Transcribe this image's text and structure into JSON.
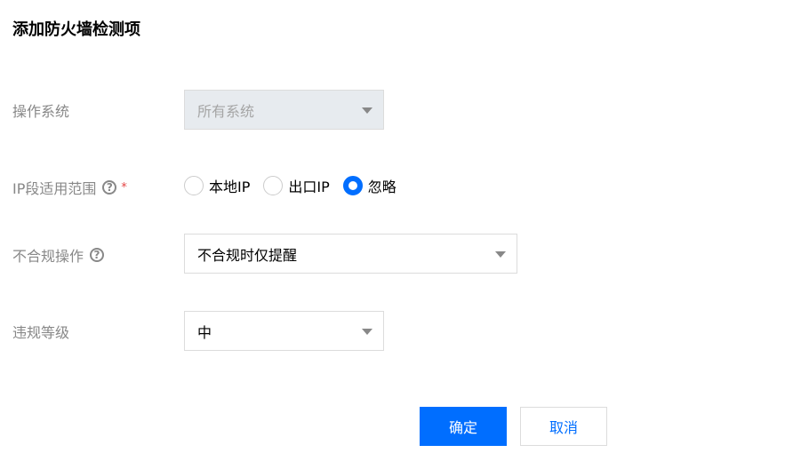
{
  "dialog": {
    "title": "添加防火墙检测项"
  },
  "form": {
    "os": {
      "label": "操作系统",
      "value": "所有系统",
      "disabled": true
    },
    "ip_range": {
      "label": "IP段适用范围",
      "required_mark": "*",
      "help_glyph": "?",
      "options": [
        "本地IP",
        "出口IP",
        "忽略"
      ],
      "selected": "忽略"
    },
    "noncompliance_action": {
      "label": "不合规操作",
      "help_glyph": "?",
      "value": "不合规时仅提醒"
    },
    "severity": {
      "label": "违规等级",
      "value": "中"
    }
  },
  "actions": {
    "confirm_label": "确定",
    "cancel_label": "取消"
  },
  "colors": {
    "primary": "#006eff",
    "required": "#e54545",
    "disabled_bg": "#e7ebef"
  },
  "icons": [
    "help-icon",
    "chevron-down-icon",
    "radio-icon"
  ]
}
